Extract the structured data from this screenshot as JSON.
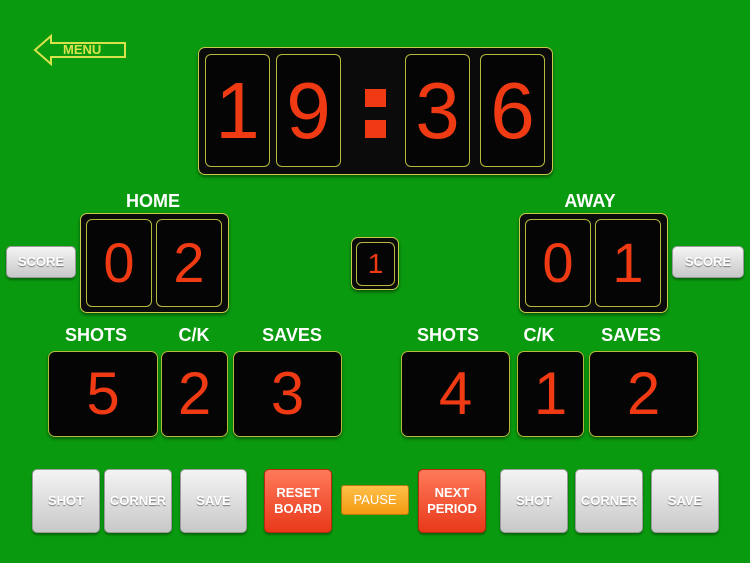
{
  "menu": {
    "label": "MENU"
  },
  "clock": {
    "digits": [
      "1",
      "9",
      "3",
      "6"
    ]
  },
  "period": {
    "value": "1"
  },
  "home": {
    "title": "HOME",
    "score": [
      "0",
      "2"
    ],
    "score_button": "SCORE",
    "stats": {
      "shots_label": "SHOTS",
      "shots": "5",
      "ck_label": "C/K",
      "ck": "2",
      "saves_label": "SAVES",
      "saves": "3"
    }
  },
  "away": {
    "title": "AWAY",
    "score": [
      "0",
      "1"
    ],
    "score_button": "SCORE",
    "stats": {
      "shots_label": "SHOTS",
      "shots": "4",
      "ck_label": "C/K",
      "ck": "1",
      "saves_label": "SAVES",
      "saves": "2"
    }
  },
  "controls": {
    "home_shot": "SHOT",
    "home_corner": "CORNER",
    "home_save": "SAVE",
    "reset_line1": "RESET",
    "reset_line2": "BOARD",
    "pause": "PAUSE",
    "next_line1": "NEXT",
    "next_line2": "PERIOD",
    "away_shot": "SHOT",
    "away_corner": "CORNER",
    "away_save": "SAVE"
  },
  "colors": {
    "background": "#0a9a0f",
    "digit": "#f03a14",
    "panel_border": "#c9c94a",
    "menu": "#d8e24a"
  }
}
